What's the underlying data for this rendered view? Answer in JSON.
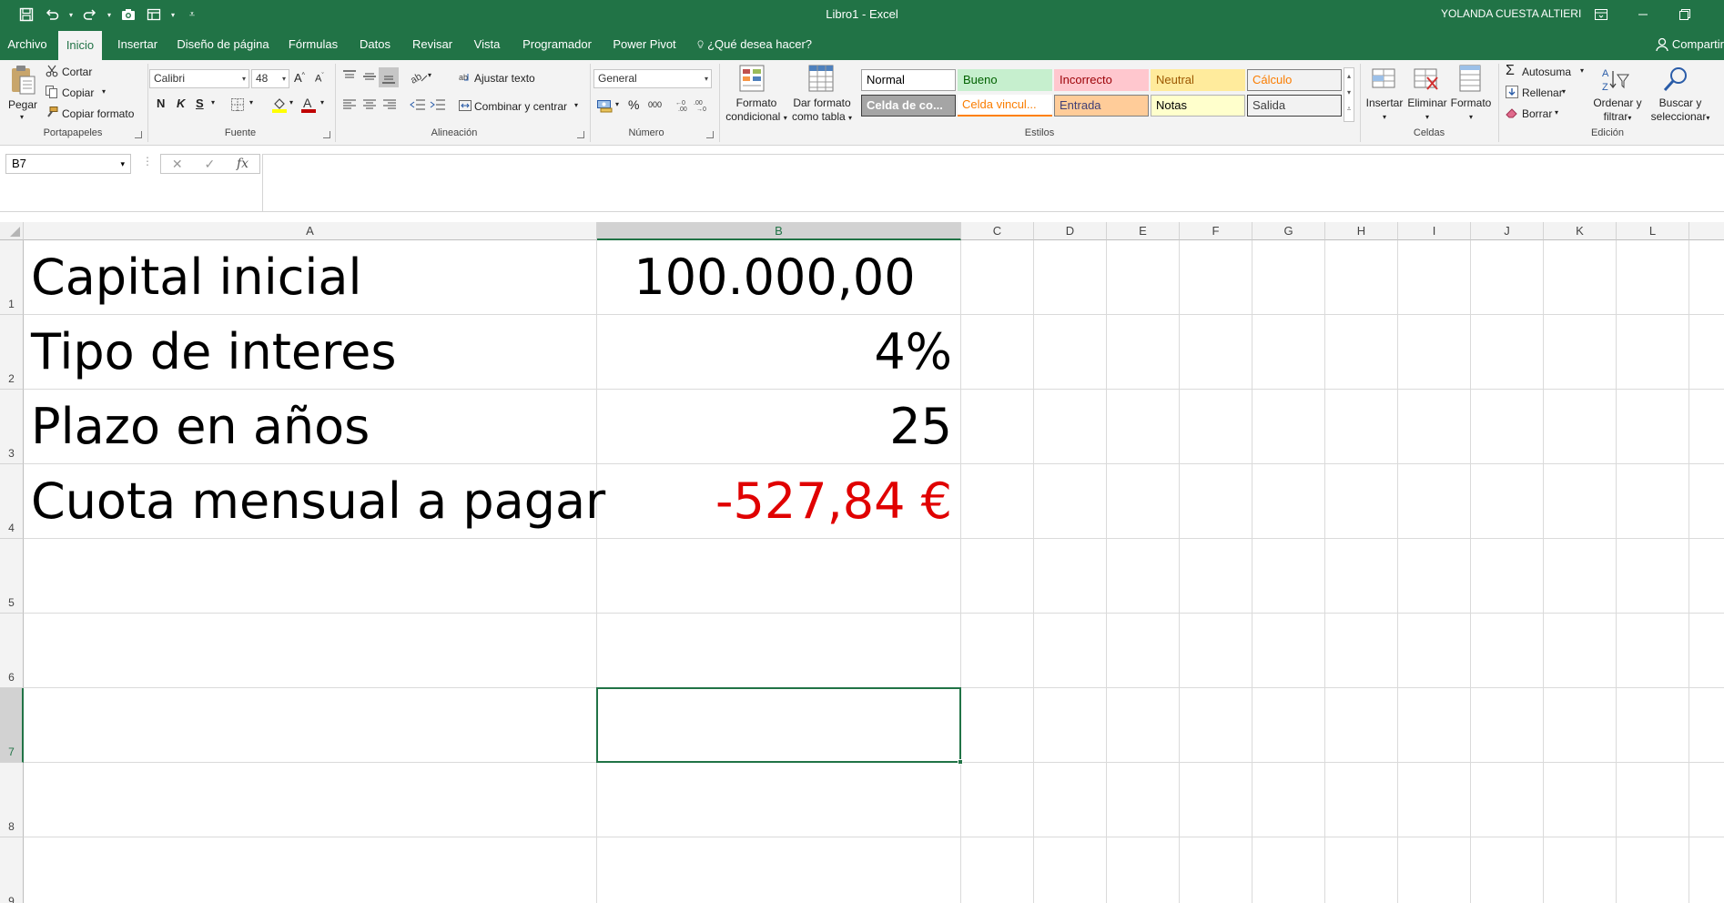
{
  "window": {
    "title": "Libro1  -  Excel",
    "user": "YOLANDA CUESTA ALTIERI",
    "qat_icons": [
      "save-icon",
      "undo-icon",
      "redo-icon",
      "camera-icon",
      "form-icon",
      "customize-icon"
    ],
    "controls": [
      "ribbon-display-icon",
      "minimize-icon",
      "restore-icon",
      "close-icon"
    ]
  },
  "tabs": [
    {
      "label": "Archivo"
    },
    {
      "label": "Inicio",
      "active": true
    },
    {
      "label": "Insertar"
    },
    {
      "label": "Diseño de página"
    },
    {
      "label": "Fórmulas"
    },
    {
      "label": "Datos"
    },
    {
      "label": "Revisar"
    },
    {
      "label": "Vista"
    },
    {
      "label": "Programador"
    },
    {
      "label": "Power Pivot"
    }
  ],
  "tell_me": "¿Qué desea hacer?",
  "share": "Compartir",
  "ribbon": {
    "portapapeles": {
      "paste": "Pegar",
      "cut": "Cortar",
      "copy": "Copiar",
      "format_painter": "Copiar formato",
      "label": "Portapapeles"
    },
    "fuente": {
      "font_name": "Calibri",
      "font_size": "48",
      "bold": "N",
      "italic": "K",
      "underline": "S",
      "label": "Fuente",
      "font_color": "#c00000",
      "fill_color": "#ffff00"
    },
    "alineacion": {
      "wrap": "Ajustar texto",
      "merge": "Combinar y centrar",
      "label": "Alineación"
    },
    "numero": {
      "format": "General",
      "percent": "%",
      "thousands": "000",
      "label": "Número"
    },
    "estilos": {
      "cond_format": [
        "Formato",
        "condicional"
      ],
      "table_format": [
        "Dar formato",
        "como tabla"
      ],
      "styles": [
        {
          "label": "Normal",
          "bg": "#ffffff",
          "color": "#000000",
          "border": "#a0a0a0"
        },
        {
          "label": "Bueno",
          "bg": "#c6efce",
          "color": "#006100",
          "border": "#c6efce"
        },
        {
          "label": "Incorrecto",
          "bg": "#ffc7ce",
          "color": "#9c0006",
          "border": "#ffc7ce"
        },
        {
          "label": "Neutral",
          "bg": "#ffeb9c",
          "color": "#9c5700",
          "border": "#ffeb9c"
        },
        {
          "label": "Cálculo",
          "bg": "#f2f2f2",
          "color": "#fa7d00",
          "border": "#7f7f7f"
        },
        {
          "label": "Celda de co...",
          "bg": "#a5a5a5",
          "color": "#ffffff",
          "border": "#3f3f3f"
        },
        {
          "label": "Celda vincul...",
          "bg": "#ffffff",
          "color": "#fa7d00",
          "border": "#ff8001"
        },
        {
          "label": "Entrada",
          "bg": "#ffcc99",
          "color": "#3f3f76",
          "border": "#7f7f7f"
        },
        {
          "label": "Notas",
          "bg": "#ffffcc",
          "color": "#000000",
          "border": "#b2b2b2"
        },
        {
          "label": "Salida",
          "bg": "#f2f2f2",
          "color": "#3f3f3f",
          "border": "#3f3f3f"
        }
      ],
      "label": "Estilos"
    },
    "celdas": {
      "insert": "Insertar",
      "delete": "Eliminar",
      "format": "Formato",
      "label": "Celdas"
    },
    "edicion": {
      "autosum": "Autosuma",
      "fill": "Rellenar",
      "clear": "Borrar",
      "sort": [
        "Ordenar y",
        "filtrar"
      ],
      "find": [
        "Buscar y",
        "seleccionar"
      ],
      "label": "Edición"
    }
  },
  "formula_bar": {
    "name_box": "B7",
    "cancel": "✕",
    "enter": "✓",
    "fx": "fx",
    "formula": ""
  },
  "sheet": {
    "columns": [
      "A",
      "B",
      "C",
      "D",
      "E",
      "F",
      "G",
      "H",
      "I",
      "J",
      "K",
      "L"
    ],
    "rows": [
      "1",
      "2",
      "3",
      "4",
      "5",
      "6",
      "7",
      "8",
      "9"
    ],
    "selected_cell": "B7",
    "cells": [
      {
        "a": "Capital inicial",
        "b": "100.000,00",
        "b_color": "#000000"
      },
      {
        "a": "Tipo de interes",
        "b": "4%",
        "b_color": "#000000"
      },
      {
        "a": "Plazo en años",
        "b": "25",
        "b_color": "#000000"
      },
      {
        "a": "Cuota mensual a pagar",
        "b": "-527,84 €",
        "b_color": "#e00000"
      }
    ]
  },
  "accent": "#217346"
}
